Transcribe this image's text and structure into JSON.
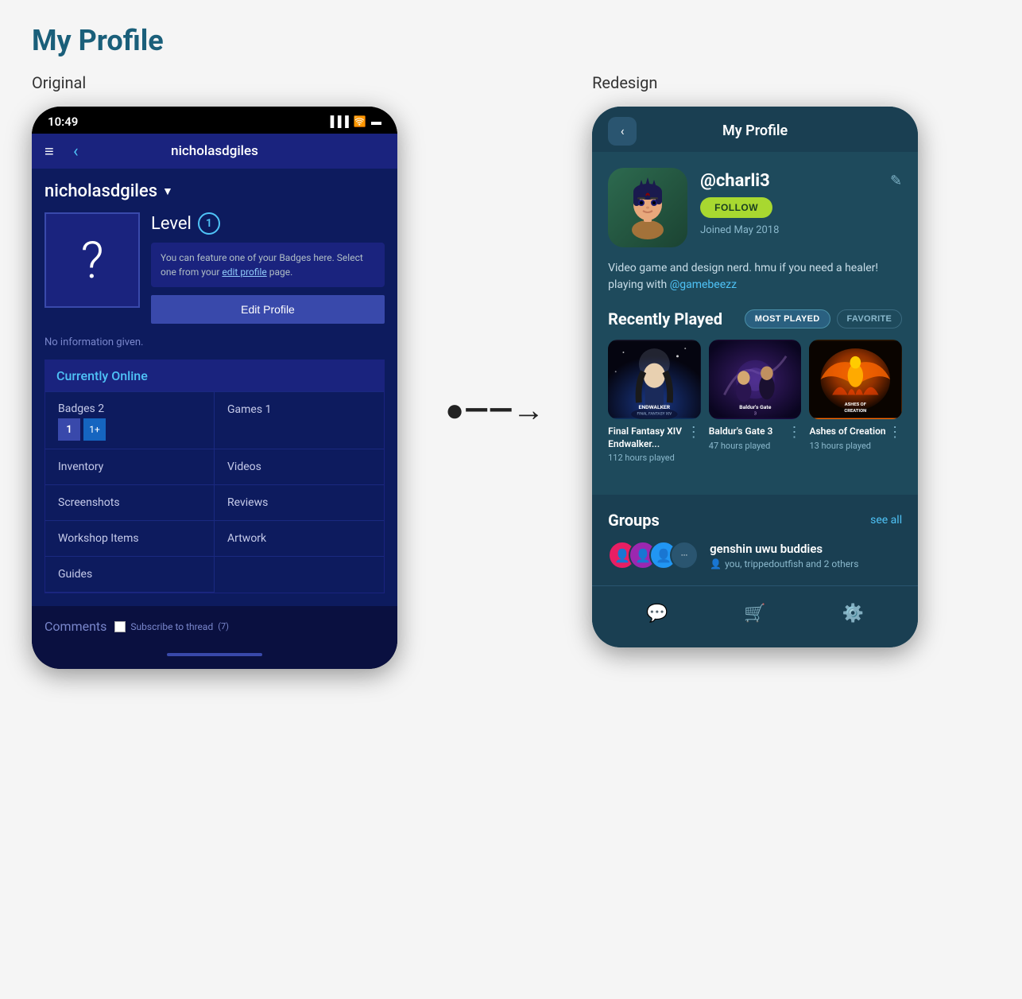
{
  "page": {
    "title": "My Profile"
  },
  "original": {
    "label": "Original",
    "statusBar": {
      "time": "10:49",
      "icons": [
        "signal",
        "wifi",
        "battery"
      ]
    },
    "header": {
      "title": "nicholasdgiles"
    },
    "username": "nicholasdgiles",
    "levelLabel": "Level",
    "levelValue": "1",
    "badgeInfo": "You can feature one of your Badges here. Select one from your edit profile page.",
    "editProfileLink": "edit profile",
    "editProfileBtn": "Edit Profile",
    "noInfo": "No information given.",
    "onlineTitle": "Currently Online",
    "gridItems": [
      {
        "label": "Badges",
        "value": "2"
      },
      {
        "label": "Games",
        "value": "1"
      },
      {
        "label": "Inventory",
        "value": ""
      },
      {
        "label": "Videos",
        "value": ""
      },
      {
        "label": "Screenshots",
        "value": ""
      },
      {
        "label": "Reviews",
        "value": ""
      },
      {
        "label": "Workshop Items",
        "value": ""
      },
      {
        "label": "Artwork",
        "value": ""
      },
      {
        "label": "Guides",
        "value": ""
      }
    ],
    "commentsLabel": "Comments",
    "subscribeLabel": "Subscribe to thread",
    "helpNum": "(7)"
  },
  "redesign": {
    "label": "Redesign",
    "header": {
      "backIcon": "‹",
      "title": "My Profile"
    },
    "username": "@charli3",
    "followBtn": "FOLLOW",
    "joinedText": "Joined May 2018",
    "bio": "Video game and design nerd. hmu if you need a healer! playing with",
    "bioMention": "@gamebeezz",
    "editIcon": "✎",
    "recentlyPlayedLabel": "Recently Played",
    "filterMostPlayed": "MOST PLAYED",
    "filterFavorite": "FAVORITE",
    "games": [
      {
        "name": "Final Fantasy XIV Endwalker...",
        "shortName": "ENDWALKER",
        "subtitle": "FINAL FANTASY XIV",
        "hours": "112 hours played"
      },
      {
        "name": "Baldur's Gate 3",
        "shortName": "Baldur's Gate",
        "hours": "47 hours played"
      },
      {
        "name": "Ashes of Creation",
        "shortName": "ASHES OF CREATION",
        "hours": "13 hours played"
      }
    ],
    "groupsLabel": "Groups",
    "seeAllLabel": "see all",
    "group": {
      "name": "genshin uwu buddies",
      "members": "you, trippedoutfish and 2 others"
    },
    "nav": {
      "chatIcon": "💬",
      "cartIcon": "🛒",
      "settingsIcon": "⚙"
    }
  },
  "arrow": "⟵→"
}
